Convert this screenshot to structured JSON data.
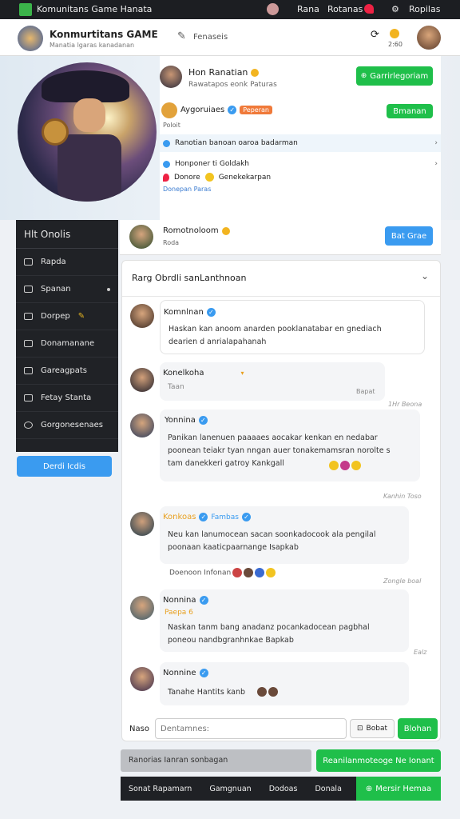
{
  "topbar": {
    "title": "Komunitans Game Hanata",
    "user": "Rana",
    "status": "Rotanas",
    "link": "Ropilas"
  },
  "header": {
    "app_name": "Konmurtitans GAME",
    "tagline": "Manatia lgaras kanadanan",
    "pen_label": "Fenaseis",
    "counter": "2:60"
  },
  "profile": {
    "name": "Hon Ranatian",
    "subtitle": "Rawatapos eonk Paturas",
    "follow_label": "Garrirlegoriam",
    "group_name": "Aygoruiaes",
    "group_badge": "Peperan",
    "group_action": "Bmanan",
    "group_sub": "Poloit",
    "link1": "Ranotian banoan oaroa badarman",
    "link2": "Honponer ti Goldakh",
    "tag_a": "Donore",
    "tag_b": "Genekekarpan",
    "tag_c": "Donepan Paras"
  },
  "sidebar": {
    "title": "Hlt Onolis",
    "items": [
      {
        "label": "Rapda",
        "icon": "list-icon"
      },
      {
        "label": "Spanan",
        "icon": "share-icon"
      },
      {
        "label": "Dorpep",
        "icon": "box-icon"
      },
      {
        "label": "Donamanane",
        "icon": "card-icon"
      },
      {
        "label": "Gareagpats",
        "icon": "tag-icon"
      },
      {
        "label": "Fetay Stanta",
        "icon": "flag-icon"
      },
      {
        "label": "Gorgonesenaes",
        "icon": "chat-icon"
      }
    ],
    "button": "Derdi Icdis"
  },
  "invite": {
    "name": "Romotnoloom",
    "sub": "Roda",
    "button": "Bat Grae"
  },
  "chat": {
    "title": "Rarg Obrdli sanLanthnoan",
    "messages": [
      {
        "name": "Komnlnan",
        "text": "Haskan kan anoom anarden pooklanatabar en gnediach dearien d anrialapahanah",
        "time": ""
      },
      {
        "name": "Konelkoha",
        "text": "Taan",
        "time": "Bapat"
      },
      {
        "name": "Yonnina",
        "text": "Panikan lanenuen paaaaes aocakar kenkan en nedabar poonean teiakr tyan nngan auer tonakemamsran norolte s tam danekkeri gatroy Kankgall",
        "time": "1Hr Beona"
      },
      {
        "name": "Konkoas",
        "badge": "Fambas",
        "text": "Neu kan lanumocean sacan soonkadocook ala pengilal poonaan kaaticpaarnange Isapkab",
        "time": "Kanhin Toso"
      },
      {
        "name": "Nonnina",
        "badge": "Paepa 6",
        "text": "Naskan tanm bang anadanz pocankadocean pagbhal poneou nandbgranhnkae Bapkab",
        "time": "Zongle boal",
        "extra": "Doenoon Infonan"
      },
      {
        "name": "Nonnine",
        "text": "Tanahe Hantits kanb",
        "time": "Ealz"
      }
    ]
  },
  "composer": {
    "label": "Naso",
    "placeholder": "Dentamnes:",
    "attach": "Bobat",
    "send": "Blohan"
  },
  "footer": {
    "gray_btn": "Ranorias Ianran sonbagan",
    "green_btn": "Reanilanmoteoge Ne Ionant",
    "tabs": [
      "Sonat Rapamarn",
      "Gamgnuan",
      "Dodoas",
      "Donala"
    ],
    "cta": "Mersir Hemaa"
  },
  "colors": {
    "green": "#1fbf4a",
    "blue": "#3a9bf0",
    "dark": "#202226"
  }
}
